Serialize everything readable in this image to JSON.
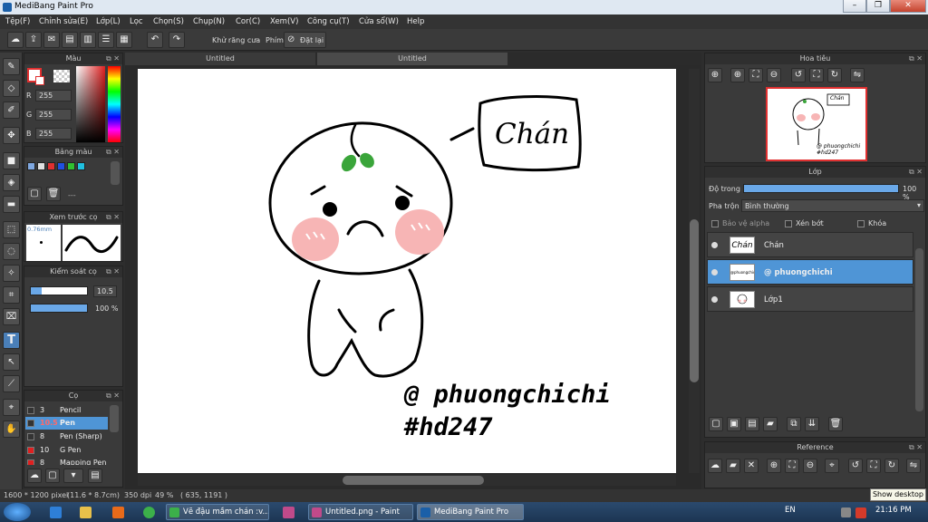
{
  "window": {
    "title": "MediBang Paint Pro"
  },
  "menu": [
    "Tệp(F)",
    "Chỉnh sửa(E)",
    "Lớp(L)",
    "Lọc",
    "Chọn(S)",
    "Chụp(N)",
    "Cor(C)",
    "Xem(V)",
    "Công cụ(T)",
    "Cửa sổ(W)",
    "Help"
  ],
  "toolbar": {
    "antialias_label": "Khử răng cưa",
    "shortcut_label": "Phím",
    "reset_label": "Đặt lại"
  },
  "color_panel": {
    "title": "Màu",
    "r": "255",
    "g": "255",
    "b": "255",
    "r_label": "R",
    "g_label": "G",
    "b_label": "B"
  },
  "palette_panel": {
    "title": "Bảng màu",
    "colors": [
      "#7fa8e0",
      "#e0e0e0",
      "#e03030",
      "#2050e0",
      "#30c030",
      "#20c0e0"
    ],
    "dash": "---"
  },
  "brush_preview": {
    "title": "Xem trước cọ",
    "size_label": "0.76mm"
  },
  "brush_control": {
    "title": "Kiểm soát cọ",
    "size": "10.5",
    "opacity": "100 %"
  },
  "brush_panel": {
    "title": "Cọ",
    "items": [
      {
        "size": "3",
        "name": "Pencil",
        "color": "#333333"
      },
      {
        "size": "10.5",
        "name": "Pen",
        "color": "#333333"
      },
      {
        "size": "8",
        "name": "Pen (Sharp)",
        "color": "#333333"
      },
      {
        "size": "10",
        "name": "G Pen",
        "color": "#e02020"
      },
      {
        "size": "8",
        "name": "Mapping Pen",
        "color": "#e02020"
      }
    ]
  },
  "tabs": [
    "Untitled",
    "Untitled"
  ],
  "canvas": {
    "bubble_text": "Chán",
    "signature_line1": "@ phuongchichi",
    "signature_line2": "#hd247"
  },
  "navigator": {
    "title": "Hoa tiêu",
    "thumb_bubble": "Chán",
    "thumb_line1": "@ phuongchichi",
    "thumb_line2": "#hd247"
  },
  "layer_panel": {
    "title": "Lớp",
    "opacity_label": "Độ trong",
    "opacity_value": "100 %",
    "opacity": 1.0,
    "blend_label": "Pha trộn",
    "blend_value": "Bình thường",
    "protect_alpha": "Bảo vệ alpha",
    "clipping": "Xén bớt",
    "lock": "Khóa",
    "layers": [
      {
        "name": "Chán",
        "thumb": "Chán"
      },
      {
        "name": "@ phuongchichi",
        "thumb": "@phuongchichi"
      },
      {
        "name": "Lớp1",
        "thumb": ""
      }
    ]
  },
  "reference_panel": {
    "title": "Reference"
  },
  "status": {
    "dimensions": "1600 * 1200 pixel",
    "physical": "(11.6 * 8.7cm)",
    "dpi": "350 dpi",
    "zoom": "49 %",
    "coords": "( 635, 1191 )"
  },
  "taskbar": {
    "tasks": [
      "Vẽ đậu mầm chán :v...",
      "Untitled.png - Paint",
      "MediBang Paint Pro"
    ],
    "lang": "EN",
    "time": "21:16 PM",
    "tooltip": "Show desktop"
  }
}
